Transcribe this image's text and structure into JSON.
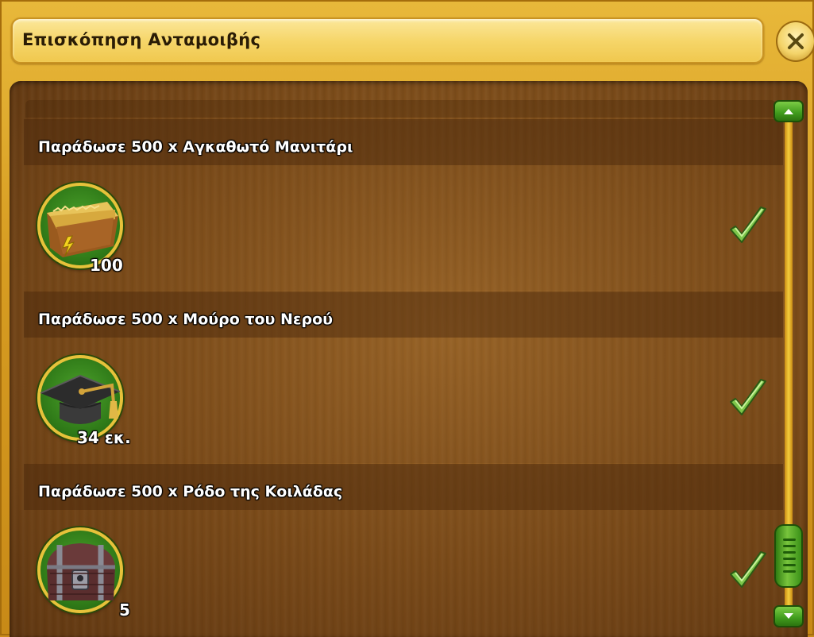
{
  "window": {
    "title": "Επισκόπηση Ανταμοιβής"
  },
  "items": [
    {
      "title": "Παράδωσε 500 x Αγκαθωτό Μανιτάρι",
      "reward_icon": "hay-bale-energy-icon",
      "reward_qty": "100",
      "completed": true
    },
    {
      "title": "Παράδωσε 500 x Μούρο του Νερού",
      "reward_icon": "graduation-cap-icon",
      "reward_qty": "34 εκ.",
      "completed": true
    },
    {
      "title": "Παράδωσε 500 x Ρόδο της Κοιλάδας",
      "reward_icon": "treasure-chest-icon",
      "reward_qty": "5",
      "completed": true
    }
  ],
  "colors": {
    "frame": "#d79d22",
    "title_bar": "#f6d66a",
    "panel_wood": "#8a5a22",
    "icon_ring": "#e6c23a",
    "icon_fill": "#3f8f22",
    "checkmark": "#7cc64a",
    "scrollbar_green": "#3f9b1c"
  }
}
